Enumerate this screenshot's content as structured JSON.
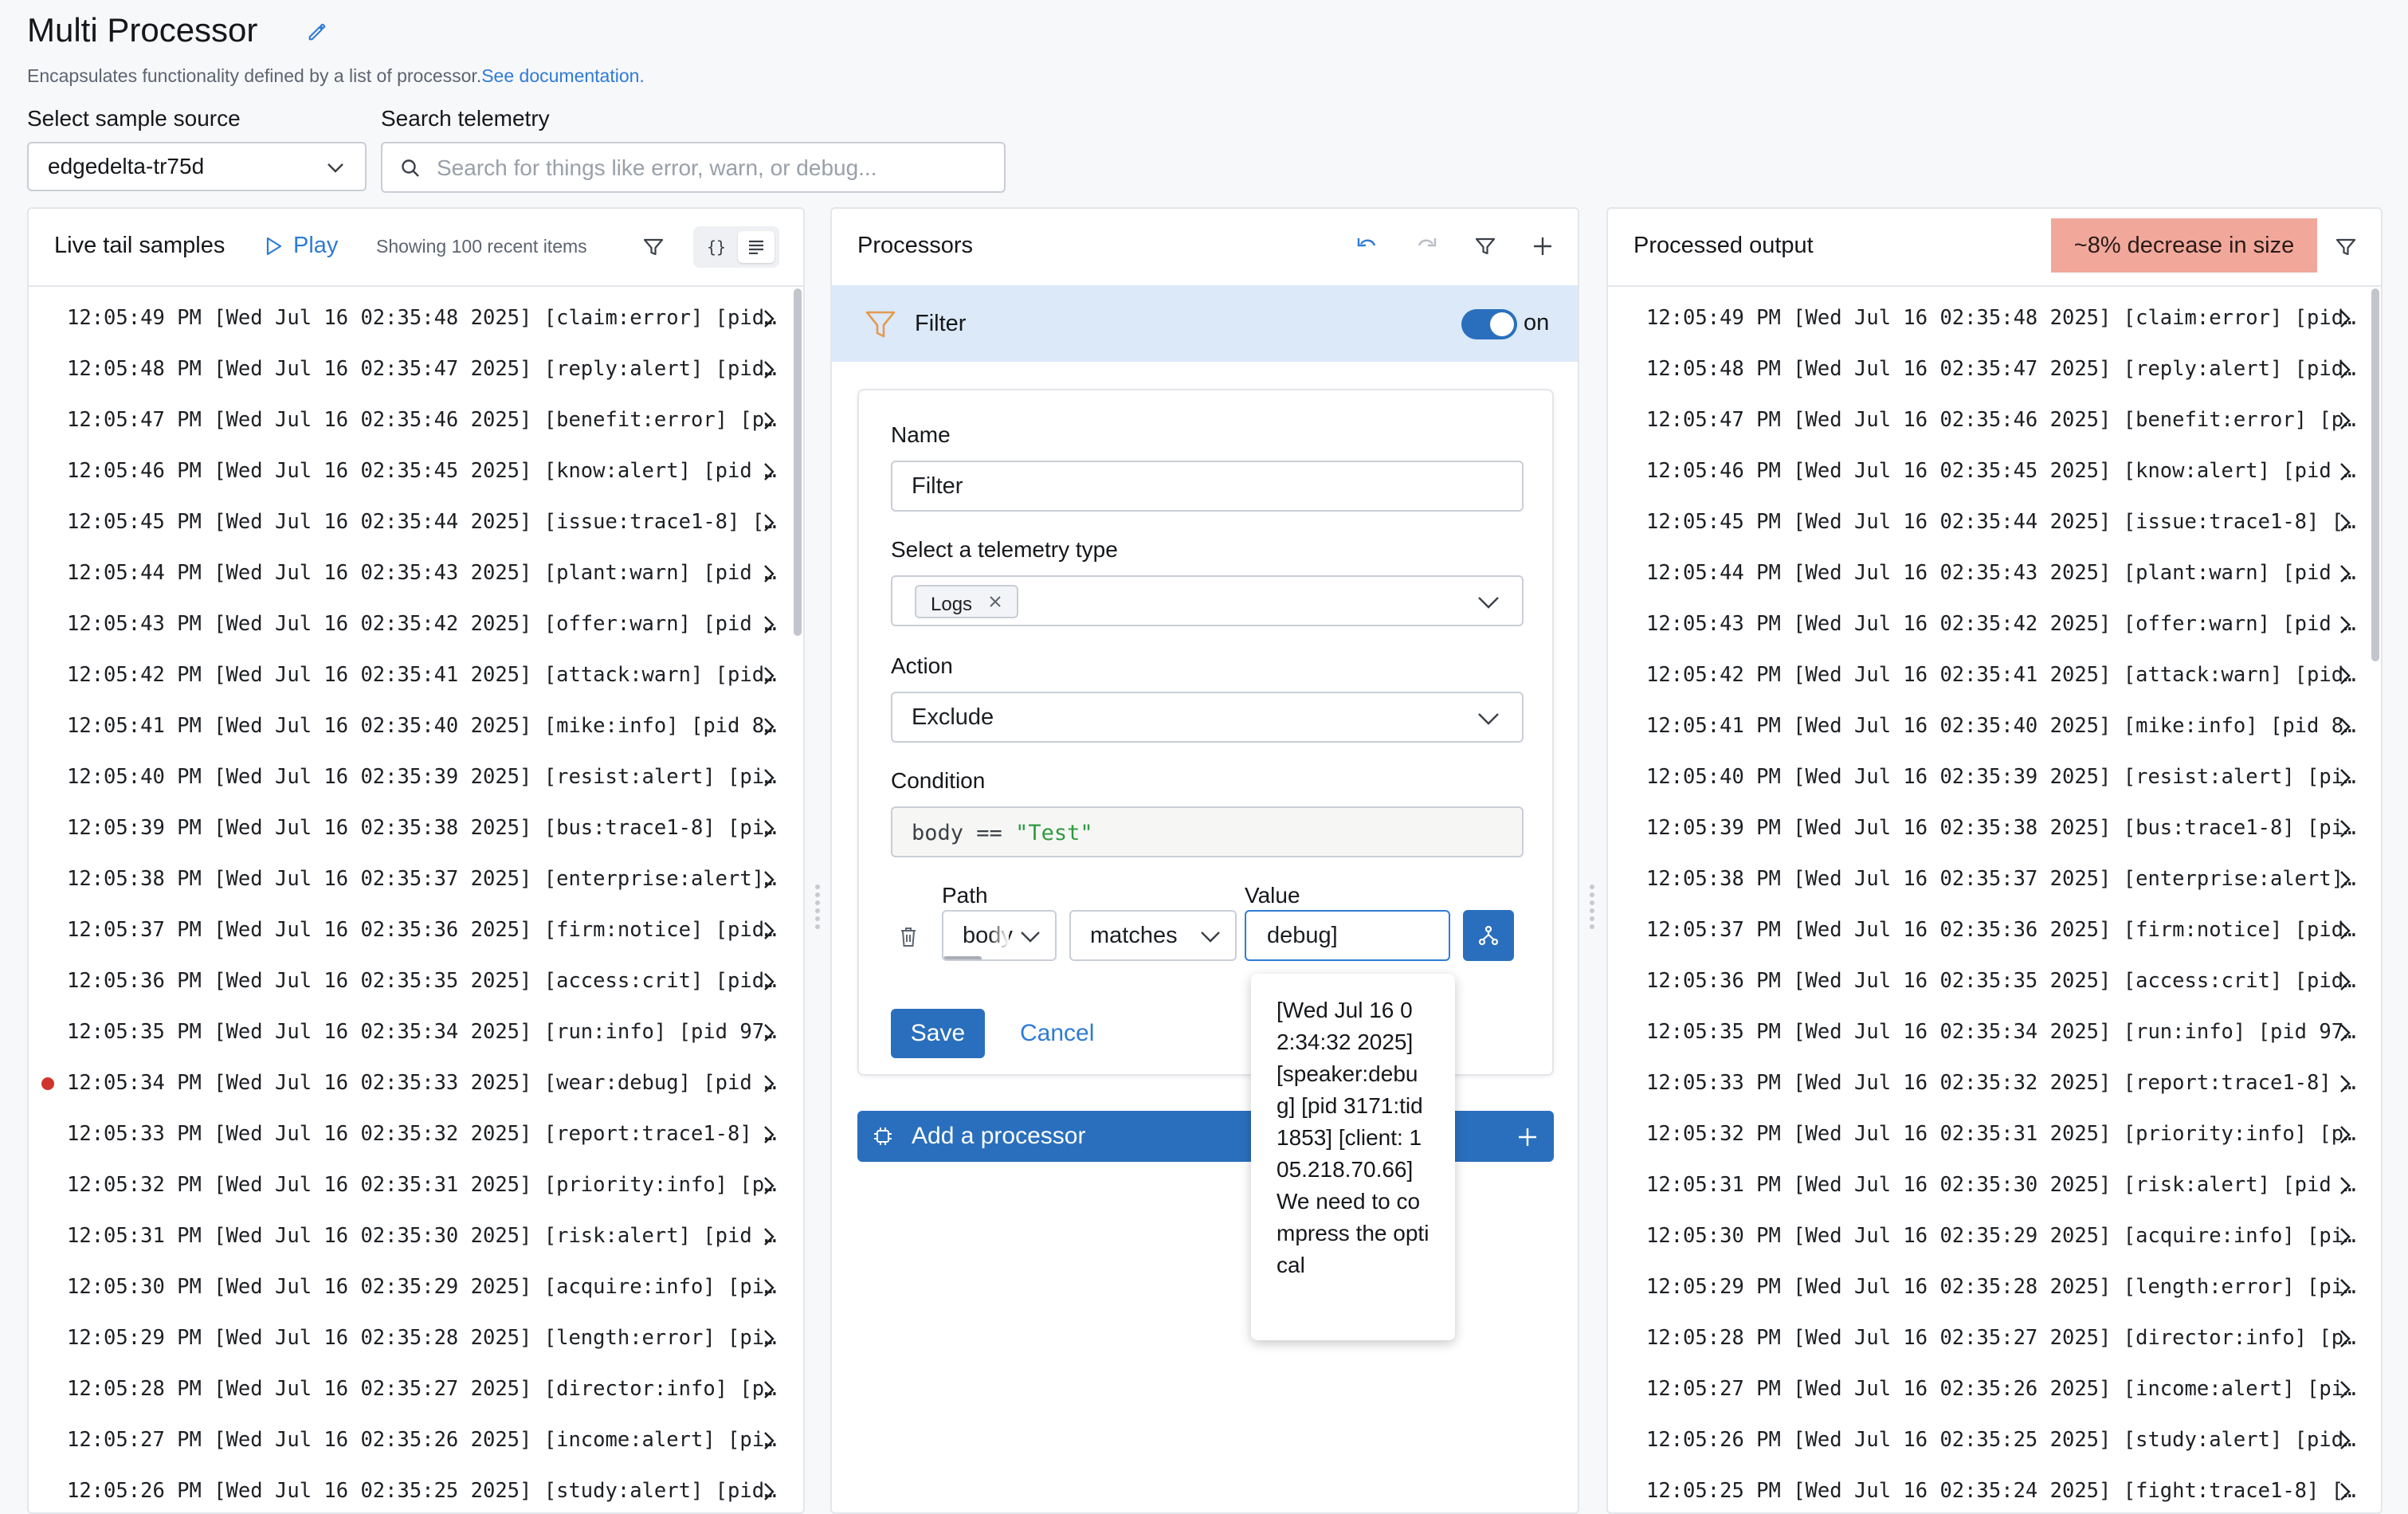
{
  "header": {
    "title": "Multi Processor",
    "description": "Encapsulates functionality defined by a list of processor.",
    "doc_link": "See documentation."
  },
  "source": {
    "label": "Select sample source",
    "value": "edgedelta-tr75d"
  },
  "search": {
    "label": "Search telemetry",
    "placeholder": "Search for things like error, warn, or debug..."
  },
  "live_tail": {
    "title": "Live tail samples",
    "play_label": "Play",
    "showing": "Showing 100 recent items",
    "json_toggle": "{}",
    "rows": [
      "12:05:49 PM [Wed Jul 16 02:35:48 2025] [claim:error] [pid…",
      "12:05:48 PM [Wed Jul 16 02:35:47 2025] [reply:alert] [pid…",
      "12:05:47 PM [Wed Jul 16 02:35:46 2025] [benefit:error] [p…",
      "12:05:46 PM [Wed Jul 16 02:35:45 2025] [know:alert] [pid …",
      "12:05:45 PM [Wed Jul 16 02:35:44 2025] [issue:trace1-8] […",
      "12:05:44 PM [Wed Jul 16 02:35:43 2025] [plant:warn] [pid …",
      "12:05:43 PM [Wed Jul 16 02:35:42 2025] [offer:warn] [pid …",
      "12:05:42 PM [Wed Jul 16 02:35:41 2025] [attack:warn] [pid…",
      "12:05:41 PM [Wed Jul 16 02:35:40 2025] [mike:info] [pid 8…",
      "12:05:40 PM [Wed Jul 16 02:35:39 2025] [resist:alert] [pi…",
      "12:05:39 PM [Wed Jul 16 02:35:38 2025] [bus:trace1-8] [pi…",
      "12:05:38 PM [Wed Jul 16 02:35:37 2025] [enterprise:alert]…",
      "12:05:37 PM [Wed Jul 16 02:35:36 2025] [firm:notice] [pid…",
      "12:05:36 PM [Wed Jul 16 02:35:35 2025] [access:crit] [pid…",
      "12:05:35 PM [Wed Jul 16 02:35:34 2025] [run:info] [pid 97…",
      "12:05:34 PM [Wed Jul 16 02:35:33 2025] [wear:debug] [pid …",
      "12:05:33 PM [Wed Jul 16 02:35:32 2025] [report:trace1-8] …",
      "12:05:32 PM [Wed Jul 16 02:35:31 2025] [priority:info] [p…",
      "12:05:31 PM [Wed Jul 16 02:35:30 2025] [risk:alert] [pid …",
      "12:05:30 PM [Wed Jul 16 02:35:29 2025] [acquire:info] [pi…",
      "12:05:29 PM [Wed Jul 16 02:35:28 2025] [length:error] [pi…",
      "12:05:28 PM [Wed Jul 16 02:35:27 2025] [director:info] [p…",
      "12:05:27 PM [Wed Jul 16 02:35:26 2025] [income:alert] [pi…",
      "12:05:26 PM [Wed Jul 16 02:35:25 2025] [study:alert] [pid…"
    ]
  },
  "processors": {
    "title": "Processors",
    "filter_name": "Filter",
    "toggle_label": "on",
    "form": {
      "name_label": "Name",
      "name_value": "Filter",
      "telemetry_label": "Select a telemetry type",
      "telemetry_tag": "Logs",
      "action_label": "Action",
      "action_value": "Exclude",
      "condition_label": "Condition",
      "condition_lhs": "body",
      "condition_op": "==",
      "condition_rhs": "\"Test\"",
      "path_label": "Path",
      "path_value": "body",
      "operator_value": "matches",
      "value_label": "Value",
      "value_value": "debug]",
      "save_label": "Save",
      "cancel_label": "Cancel"
    },
    "suggestion": "[Wed Jul 16 02:34:32 2025] [speaker:debug] [pid 3171:tid 1853] [client: 105.218.70.66] We need to compress the optical",
    "add_label": "Add a processor"
  },
  "output": {
    "title": "Processed output",
    "badge": "~8% decrease in size",
    "rows": [
      "12:05:49 PM [Wed Jul 16 02:35:48 2025] [claim:error] [pid…",
      "12:05:48 PM [Wed Jul 16 02:35:47 2025] [reply:alert] [pid…",
      "12:05:47 PM [Wed Jul 16 02:35:46 2025] [benefit:error] [p…",
      "12:05:46 PM [Wed Jul 16 02:35:45 2025] [know:alert] [pid …",
      "12:05:45 PM [Wed Jul 16 02:35:44 2025] [issue:trace1-8] […",
      "12:05:44 PM [Wed Jul 16 02:35:43 2025] [plant:warn] [pid …",
      "12:05:43 PM [Wed Jul 16 02:35:42 2025] [offer:warn] [pid …",
      "12:05:42 PM [Wed Jul 16 02:35:41 2025] [attack:warn] [pid…",
      "12:05:41 PM [Wed Jul 16 02:35:40 2025] [mike:info] [pid 8…",
      "12:05:40 PM [Wed Jul 16 02:35:39 2025] [resist:alert] [pi…",
      "12:05:39 PM [Wed Jul 16 02:35:38 2025] [bus:trace1-8] [pi…",
      "12:05:38 PM [Wed Jul 16 02:35:37 2025] [enterprise:alert]…",
      "12:05:37 PM [Wed Jul 16 02:35:36 2025] [firm:notice] [pid…",
      "12:05:36 PM [Wed Jul 16 02:35:35 2025] [access:crit] [pid…",
      "12:05:35 PM [Wed Jul 16 02:35:34 2025] [run:info] [pid 97…",
      "12:05:33 PM [Wed Jul 16 02:35:32 2025] [report:trace1-8] …",
      "12:05:32 PM [Wed Jul 16 02:35:31 2025] [priority:info] [p…",
      "12:05:31 PM [Wed Jul 16 02:35:30 2025] [risk:alert] [pid …",
      "12:05:30 PM [Wed Jul 16 02:35:29 2025] [acquire:info] [pi…",
      "12:05:29 PM [Wed Jul 16 02:35:28 2025] [length:error] [pi…",
      "12:05:28 PM [Wed Jul 16 02:35:27 2025] [director:info] [p…",
      "12:05:27 PM [Wed Jul 16 02:35:26 2025] [income:alert] [pi…",
      "12:05:26 PM [Wed Jul 16 02:35:25 2025] [study:alert] [pid…",
      "12:05:25 PM [Wed Jul 16 02:35:24 2025] [fight:trace1-8] […"
    ]
  },
  "colors": {
    "accent": "#2a6fbd",
    "highlight_bar": "#dbe9f9",
    "badge_bg": "#f1a89b",
    "error_dot": "#d0342c",
    "string_green": "#2f9a3f"
  }
}
